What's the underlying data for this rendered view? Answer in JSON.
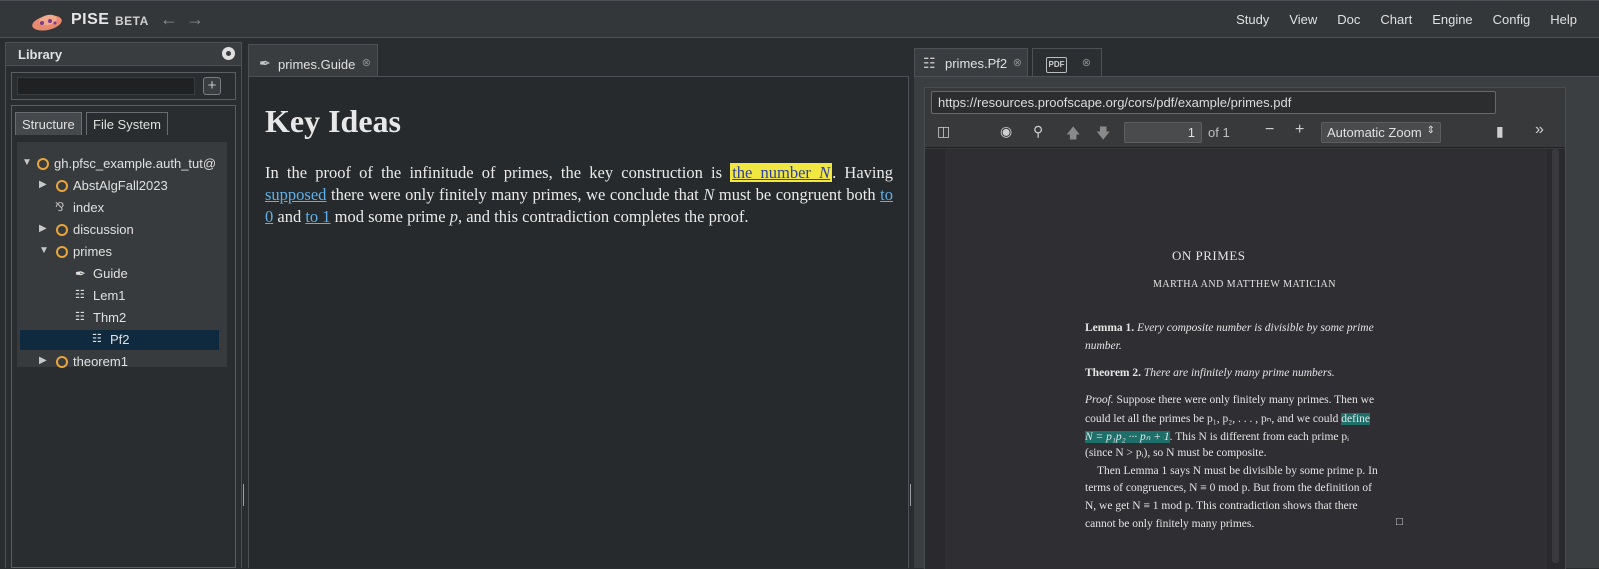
{
  "app": {
    "name": "PISE",
    "beta": "BETA"
  },
  "menu": [
    "Study",
    "View",
    "Doc",
    "Chart",
    "Engine",
    "Config",
    "Help"
  ],
  "library": {
    "title": "Library",
    "search_value": "",
    "add_label": "+",
    "tabs": [
      "Structure",
      "File System"
    ],
    "tree": [
      {
        "label": "gh.pfsc_example.auth_tut@"
      },
      {
        "label": "AbstAlgFall2023"
      },
      {
        "label": "index"
      },
      {
        "label": "discussion"
      },
      {
        "label": "primes"
      },
      {
        "label": "Guide"
      },
      {
        "label": "Lem1"
      },
      {
        "label": "Thm2"
      },
      {
        "label": "Pf2"
      },
      {
        "label": "theorem1"
      }
    ]
  },
  "center": {
    "tab_label": "primes.Guide",
    "heading": "Key Ideas",
    "p1": "In the proof of the infinitude of primes, the key construction is ",
    "link_number": "the number ",
    "link_number_var": "N",
    "p2": ". Having ",
    "link_supposed": "supposed",
    "p3": " there were only finitely many primes, we conclude that ",
    "var_N": "N",
    "p4": " must be congruent both ",
    "link_to0": "to 0",
    "p5": " and ",
    "link_to1": "to 1",
    "p6": " mod some prime ",
    "var_p": "p",
    "p7": ", and this contradiction completes the proof."
  },
  "right": {
    "tab1_label": "primes.Pf2",
    "tab2_icon": "PDF",
    "url": "https://resources.proofscape.org/cors/pdf/example/primes.pdf",
    "page_number": "1",
    "page_of": "of 1",
    "zoom": "Automatic Zoom",
    "pdf": {
      "title": "ON PRIMES",
      "authors": "MARTHA AND MATTHEW MATICIAN",
      "lemma_label": "Lemma 1.",
      "lemma_text_a": "Every composite number is divisible by some prime",
      "lemma_text_b": "number.",
      "thm_label": "Theorem 2.",
      "thm_text": "There are infinitely many prime numbers.",
      "proof_1a": "Proof.",
      "proof_1b": " Suppose there were only finitely many primes. Then we",
      "proof_2a": "could let all the primes be p₁, p₂, . . . , pₙ, and we could ",
      "proof_2b": "define",
      "proof_3a": "N = p₁p₂ ··· pₙ + 1",
      "proof_3b": ".  This N is different from each prime pᵢ",
      "proof_4": "(since N > pᵢ), so N must be composite.",
      "proof_5": "Then Lemma 1 says N must be divisible by some prime p. In",
      "proof_6": "terms of congruences, N ≡ 0   mod p. But from the definition of",
      "proof_7": "N, we get N ≡ 1   mod p. This contradiction shows that there",
      "proof_8": "cannot be only finitely many primes.",
      "qed": "□"
    }
  },
  "colors": {
    "accent": "#e9a53a",
    "highlight": "#f2e640",
    "link": "#5fb0ea",
    "pdf_highlight": "#1e6f6a"
  }
}
